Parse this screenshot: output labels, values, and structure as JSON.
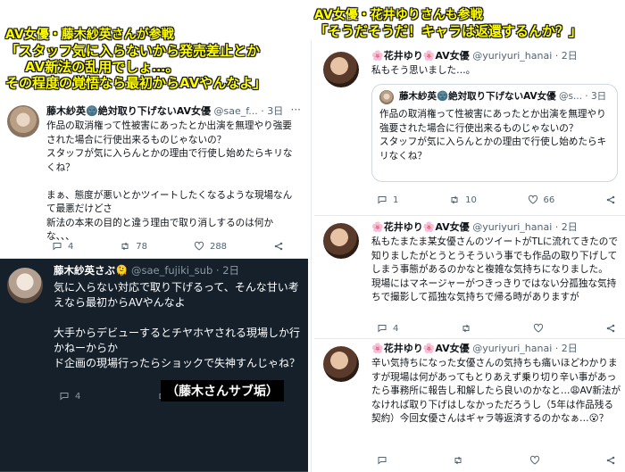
{
  "left_caption": {
    "line1": "AV女優・藤木紗英さんが参戦",
    "line2": "「スタッフ気に入らないから発売差止とか",
    "line3": "AV新法の乱用でしょ…。",
    "line4": "その程度の覚悟なら最初からAVやんなよ」"
  },
  "right_caption": {
    "line1": "AV女優・花井ゆりさんも参戦",
    "line2": "「そうだそうだ！キャラは返還するんか？」"
  },
  "tweet_sae": {
    "name": "藤木紗英🌚絶対取り下げないAV女優",
    "handle": "@sae_f...",
    "time": "3日",
    "body": "作品の取消権って性被害にあったとか出演を無理やり強要された場合に行使出来るものじゃないの？\nスタッフが気に入らんとかの理由で行使し始めたらキリなくね？\n\nまぁ、態度が悪いとかツイートしたくなるような現場なんて最悪だけどさ\n新法の本来の目的と違う理由で取り消しするのは何かな、、、",
    "replies": "4",
    "retweets": "78",
    "likes": "288"
  },
  "tweet_sub": {
    "name": "藤木紗英さぶ🫠",
    "handle": "@sae_fujiki_sub",
    "time": "2日",
    "body": "気に入らない対応で取り下げるって、そんな甘い考えなら最初からAVやんなよ\n\n大手からデビューするとチヤホヤされる現場しか行かねーからか\nド企画の現場行ったらショックで失神すんじゃね？",
    "replies": "4",
    "retweets": "",
    "likes": "",
    "label": "（藤木さんサブ垢）"
  },
  "tweet_yuri1": {
    "name": "🌸花井ゆり🌸AV女優",
    "handle": "@yuriyuri_hanai",
    "time": "2日",
    "body": "私もそう思いました…。",
    "quote": {
      "name": "藤木紗英🌚絶対取り下げないAV女優",
      "handle": "@s...",
      "time": "3日",
      "body": "作品の取消権って性被害にあったとか出演を無理やり強要された場合に行使出来るものじゃないの？\nスタッフが気に入らんとかの理由で行使し始めたらキリなくね？"
    },
    "replies": "1",
    "retweets": "10",
    "likes": "66"
  },
  "tweet_yuri2": {
    "name": "🌸花井ゆり🌸AV女優",
    "handle": "@yuriyuri_hanai",
    "time": "2日",
    "body": "私もたまたま某女優さんのツイートがTLに流れてきたので知りましたがとうとうそういう事でも作品の取り下げしてしまう事態があるのかなと複雑な気持ちになりました。\n現場にはマネージャーがつきっきりではない分孤独な気持ちで撮影して孤独な気持ちで帰る時がありますが",
    "replies": "4",
    "retweets": "",
    "likes": ""
  },
  "tweet_yuri3": {
    "name": "🌸花井ゆり🌸AV女優",
    "handle": "@yuriyuri_hanai",
    "time": "2日",
    "body": "辛い気持ちになった女優さんの気持ちも痛いほどわかりますが現場は何があってもとりあえず乗り切り辛い事があったら事務所に報告し和解したら良いのかなと…😩AV新法がなければ取り下げはしなかっただろうし（5年は作品残る契約）今回女優さんはギャラ等返済するのかなぁ…😮？",
    "replies": "",
    "retweets": "",
    "likes": ""
  },
  "colors": {
    "caption": "#ffff00",
    "dark_bg": "#15202b",
    "meta": "#536471",
    "accent_pink": "#e23b77"
  },
  "icons": [
    "reply-icon",
    "retweet-icon",
    "like-icon",
    "share-icon"
  ]
}
